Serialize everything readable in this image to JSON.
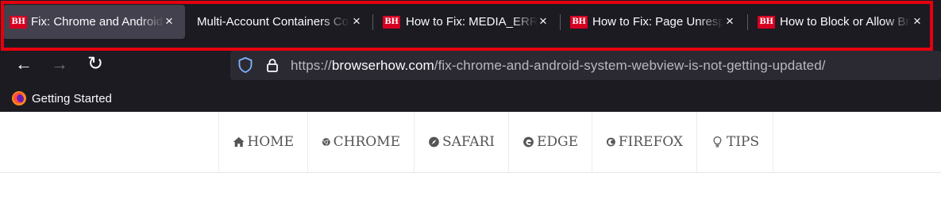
{
  "tabs": [
    {
      "label": "Fix: Chrome and Android System WebView",
      "favicon": "BH",
      "active": true
    },
    {
      "label": "Multi-Account Containers Collection",
      "favicon": "",
      "active": false
    },
    {
      "label": "How to Fix: MEDIA_ERR_SRC_NOT_SUPPORTED",
      "favicon": "BH",
      "active": false
    },
    {
      "label": "How to Fix: Page Unresponsive",
      "favicon": "BH",
      "active": false
    },
    {
      "label": "How to Block or Allow Browser",
      "favicon": "BH",
      "active": false
    }
  ],
  "close_glyph": "×",
  "nav": {
    "back": "←",
    "forward": "→",
    "reload": "↻"
  },
  "url": {
    "prefix": "https://",
    "domain": "browserhow.com",
    "path": "/fix-chrome-and-android-system-webview-is-not-getting-updated/"
  },
  "bookmarks": [
    {
      "label": "Getting Started",
      "icon": "firefox-icon"
    }
  ],
  "site_nav": [
    {
      "label": "HOME",
      "icon": "home-icon"
    },
    {
      "label": "CHROME",
      "icon": "chrome-icon"
    },
    {
      "label": "SAFARI",
      "icon": "safari-icon"
    },
    {
      "label": "EDGE",
      "icon": "edge-icon"
    },
    {
      "label": "FIREFOX",
      "icon": "firefox-icon"
    },
    {
      "label": "TIPS",
      "icon": "lightbulb-icon"
    }
  ],
  "colors": {
    "chrome_bg": "#1c1b22",
    "active_tab": "#42414d",
    "highlight": "#e5000f",
    "favicon": "#d70022",
    "urlbar": "#2b2a33"
  }
}
